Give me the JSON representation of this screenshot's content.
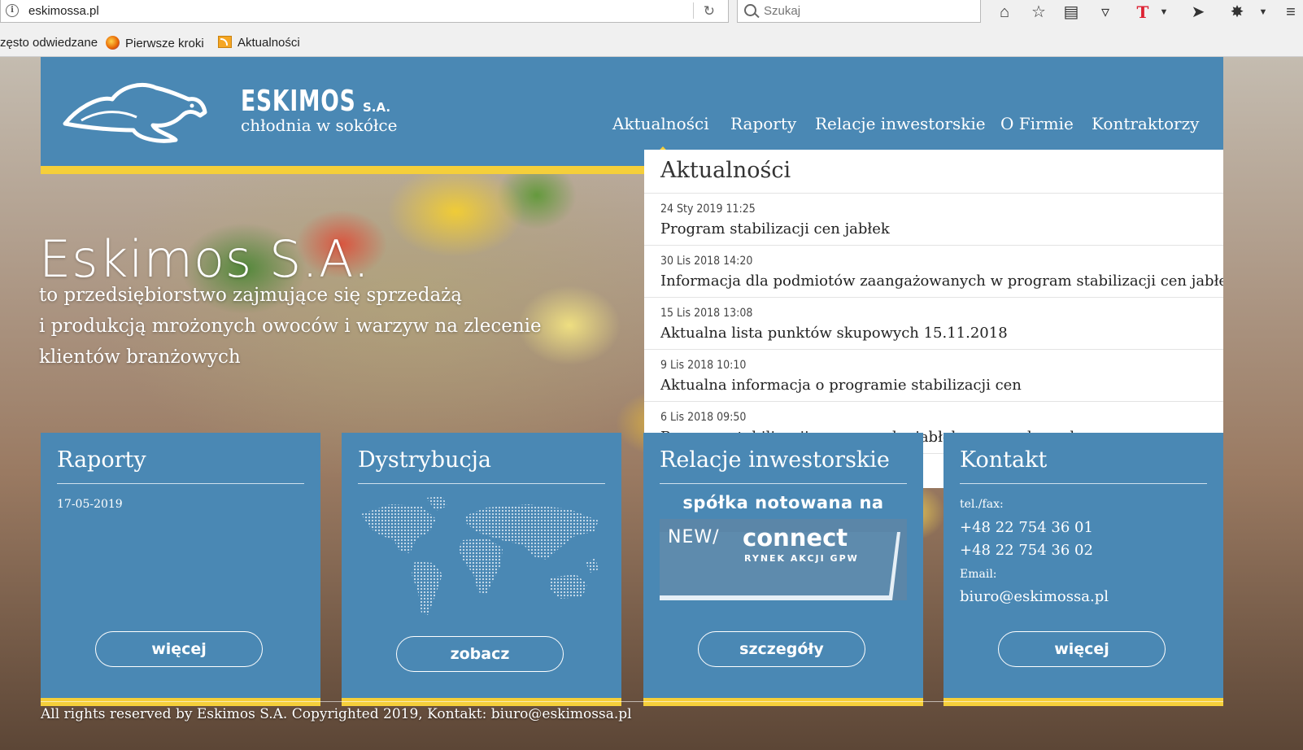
{
  "browser": {
    "url": "eskimossa.pl",
    "search_placeholder": "Szukaj",
    "bookmarks": [
      "zęsto odwiedzane",
      "Pierwsze kroki",
      "Aktualności"
    ]
  },
  "header": {
    "logo_title": "ESKIMOS",
    "logo_sa": "S.A.",
    "logo_sub": "chłodnia w sokółce",
    "nav": [
      "Aktualności",
      "Raporty",
      "Relacje inwestorskie",
      "O Firmie",
      "Kontraktorzy"
    ]
  },
  "hero": {
    "title": "Eskimos S.A.",
    "lines": [
      "to przedsiębiorstwo zajmujące się sprzedażą",
      "i produkcją mrożonych owoców i warzyw na zlecenie",
      "klientów branżowych"
    ]
  },
  "news": {
    "title": "Aktualności",
    "items": [
      {
        "date": "24 Sty 2019 11:25",
        "text": "Program stabilizacji cen jabłek"
      },
      {
        "date": "30 Lis 2018 14:20",
        "text": "Informacja dla podmiotów zaangażowanych w program stabilizacji cen jabłek"
      },
      {
        "date": "15 Lis 2018 13:08",
        "text": "Aktualna lista punktów skupowych 15.11.2018"
      },
      {
        "date": "9 Lis 2018 10:10",
        "text": "Aktualna informacja o programie stabilizacji cen"
      },
      {
        "date": "6 Lis 2018 09:50",
        "text": "Program stabilizacji cen na rynku jabłek przemysłowych"
      }
    ]
  },
  "cards": {
    "raporty": {
      "title": "Raporty",
      "date": "17-05-2019",
      "button": "więcej"
    },
    "dystrybucja": {
      "title": "Dystrybucja",
      "button": "zobacz"
    },
    "relacje": {
      "title": "Relacje inwestorskie",
      "banner_top": "spółka notowana na",
      "banner_new": "NEW/",
      "banner_connect": "connect",
      "banner_sub": "RYNEK AKCJI GPW",
      "button": "szczegóły"
    },
    "kontakt": {
      "title": "Kontakt",
      "tel_label": "tel./fax:",
      "phone1": "+48 22 754 36 01",
      "phone2": "+48 22 754 36 02",
      "email_label": "Email:",
      "email": "biuro@eskimossa.pl",
      "button": "więcej"
    }
  },
  "footer": {
    "text": "All rights reserved by Eskimos S.A. Copyrighted 2019, Kontakt: biuro@eskimossa.pl"
  }
}
